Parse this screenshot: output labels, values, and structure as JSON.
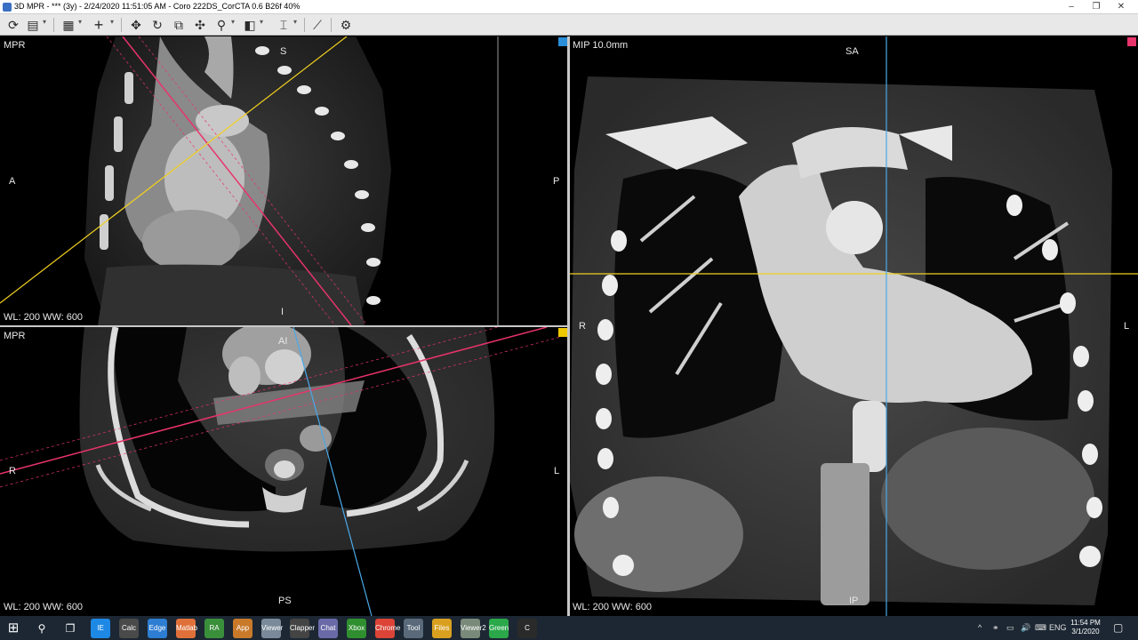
{
  "window": {
    "title": "3D MPR - *** (3y) - 2/24/2020 11:51:05 AM - Coro  222DS_CorCTA  0.6  B26f  40%",
    "minimize": "–",
    "restore": "❐",
    "close": "✕"
  },
  "toolbar": {
    "refresh": "⟳",
    "save": "▤",
    "layout": "▦",
    "crosshair": "+",
    "pan": "✥",
    "rotate": "↻",
    "stack": "⧉",
    "move": "✣",
    "zoom": "⚲",
    "window_level": "◧",
    "thickness": "⌶",
    "measure": "⟋",
    "settings": "⚙",
    "caret": "▾"
  },
  "viewports": {
    "sagittal": {
      "title": "MPR",
      "top": "S",
      "bottom": "I",
      "left": "A",
      "right": "P",
      "window": "WL: 200 WW: 600"
    },
    "axial": {
      "title": "MPR",
      "top": "AI",
      "bottom": "PS",
      "left": "R",
      "right": "L",
      "window": "WL: 200 WW: 600"
    },
    "coronal": {
      "title": "MIP 10.0mm",
      "top": "SA",
      "bottom": "IP",
      "left": "R",
      "right": "L",
      "window": "WL: 200 WW: 600"
    }
  },
  "colors": {
    "sagittal_line": "#e8336b",
    "axial_line": "#f0d020",
    "coronal_line": "#4aa8e8",
    "sagittal_marker": "#e8336b",
    "axial_marker": "#f0c800",
    "coronal_marker": "#2a8fd8"
  },
  "taskbar": {
    "start": "⊞",
    "search": "⚲",
    "taskview": "❐",
    "apps": [
      "IE",
      "Calc",
      "Edge",
      "Matlab",
      "RA",
      "App",
      "Viewer",
      "Clapper",
      "Chat",
      "Xbox",
      "Chrome",
      "Tool",
      "Files",
      "Viewer2",
      "Green",
      "C"
    ],
    "tray": [
      "^",
      "⚭",
      "▭",
      "🔊",
      "⌨",
      "ENG"
    ],
    "time": "11:54 PM",
    "date": "3/1/2020",
    "notification": "▢"
  }
}
